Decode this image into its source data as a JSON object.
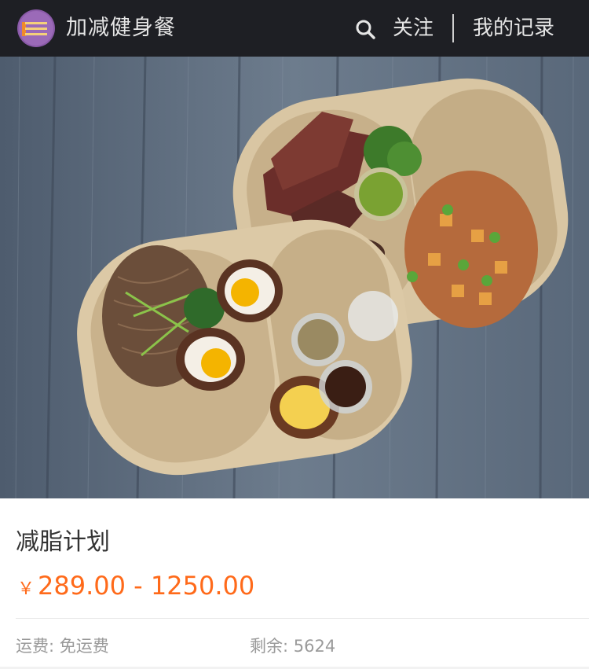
{
  "header": {
    "brand": "加减健身餐",
    "follow_label": "关注",
    "records_label": "我的记录"
  },
  "icons": {
    "search": "search-icon",
    "logo": "brand-logo"
  },
  "banner": {
    "active_index": 2,
    "total": 5
  },
  "product": {
    "title": "减脂计划",
    "currency": "￥",
    "price_range": "289.00 - 1250.00",
    "shipping": "运费: 免运费",
    "stock": "剩余: 5624"
  },
  "colors": {
    "header_bg": "#1e1f24",
    "price": "#ff6a1a",
    "active_dot": "#ff4b1f"
  }
}
